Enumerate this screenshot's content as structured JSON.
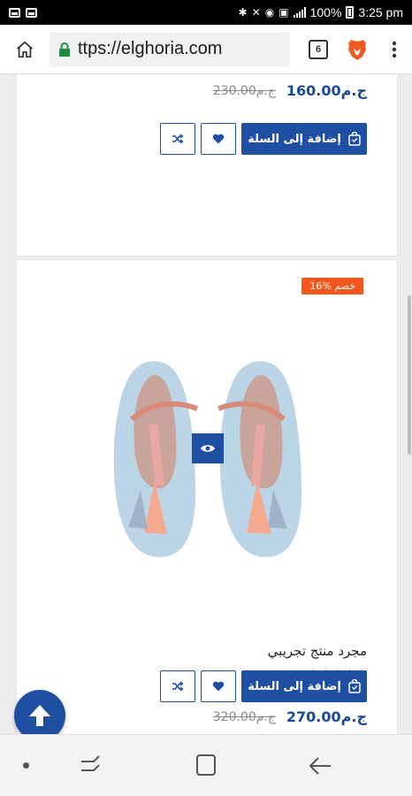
{
  "status_bar": {
    "battery": "100%",
    "time": "3:25 pm"
  },
  "browser": {
    "url": "ttps://elghoria.com",
    "tab_count": "6"
  },
  "products": [
    {
      "old_price": "230.00ج.م",
      "new_price": "160.00ج.م",
      "add_to_cart": "إضافة إلى السلة"
    },
    {
      "discount": "16% خصم",
      "title": "مجرد منتج تجريبي",
      "rating": 0,
      "old_price": "320.00ج.م",
      "new_price": "270.00ج.م",
      "add_to_cart": "إضافة إلى السلة"
    }
  ],
  "colors": {
    "primary": "#1f4fa3",
    "discount": "#f2571d",
    "price": "#1a4a93"
  }
}
